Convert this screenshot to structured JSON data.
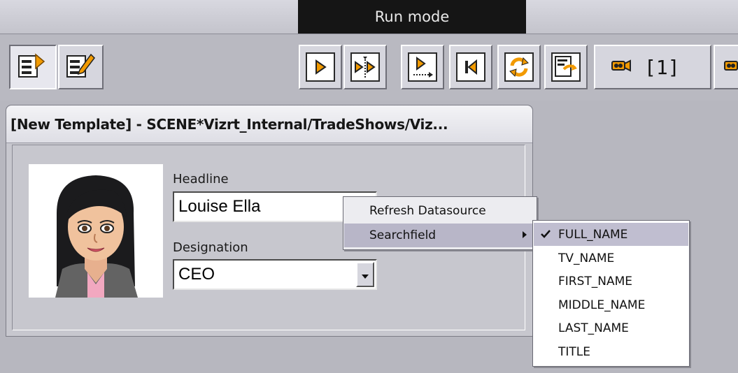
{
  "window": {
    "mode_title": "Run mode"
  },
  "toolbar": {
    "left_buttons": [
      {
        "icon": "template-list-icon"
      },
      {
        "icon": "edit-template-icon"
      }
    ],
    "playout_buttons": [
      {
        "icon": "play-icon"
      },
      {
        "icon": "continue-icon"
      },
      {
        "icon": "take-out-icon"
      },
      {
        "icon": "rewind-icon"
      },
      {
        "icon": "refresh-icon"
      },
      {
        "icon": "preview-icon"
      }
    ],
    "camera_label": "[1]",
    "accent_color": "#f29a00"
  },
  "panel": {
    "title": "[New Template] - SCENE*Vizrt_Internal/TradeShows/Viz..."
  },
  "form": {
    "headline_label": "Headline",
    "headline_value": "Louise Ella",
    "designation_label": "Designation",
    "designation_value": "CEO"
  },
  "context_menu": {
    "items": [
      {
        "label": "Refresh Datasource"
      },
      {
        "label": "Searchfield"
      }
    ]
  },
  "submenu": {
    "items": [
      {
        "label": "FULL_NAME",
        "checked": true
      },
      {
        "label": "TV_NAME"
      },
      {
        "label": "FIRST_NAME"
      },
      {
        "label": "MIDDLE_NAME"
      },
      {
        "label": "LAST_NAME"
      },
      {
        "label": "TITLE"
      }
    ]
  }
}
